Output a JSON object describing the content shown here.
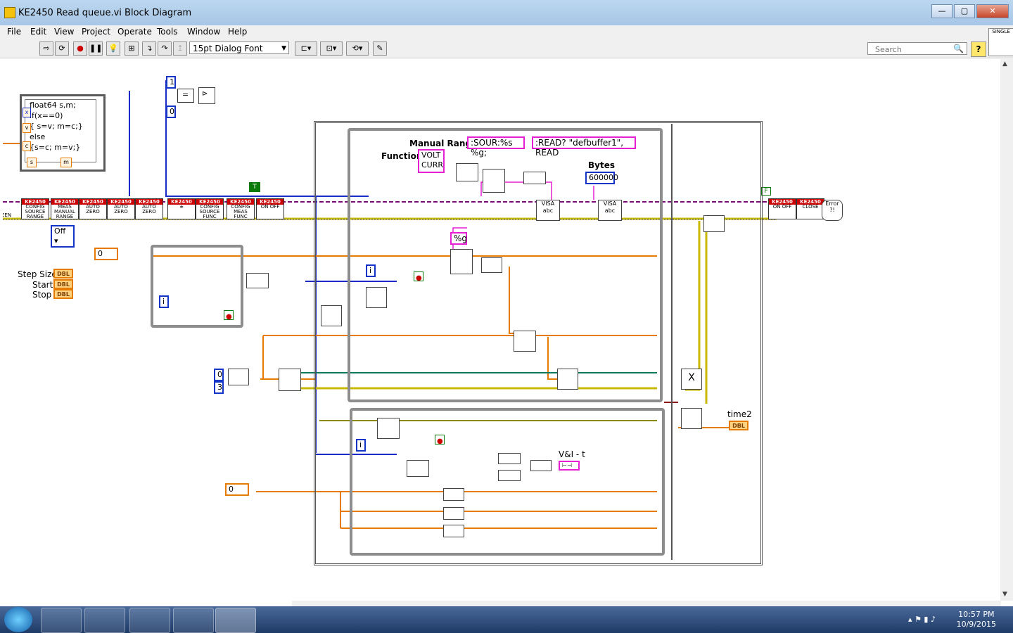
{
  "window": {
    "title": "KE2450 Read queue.vi Block Diagram"
  },
  "menu": [
    "File",
    "Edit",
    "View",
    "Project",
    "Operate",
    "Tools",
    "Window",
    "Help"
  ],
  "toolbar": {
    "font": "15pt Dialog Font"
  },
  "search": {
    "placeholder": "Search"
  },
  "single_badge": "SINGLE",
  "diagram": {
    "formula_lines": [
      "float64 s,m;",
      "if(x==0)",
      "{ s=v; m=c;}",
      "else",
      "{s=c; m=v;}"
    ],
    "formula_inputs": [
      "x",
      "v",
      "c"
    ],
    "formula_outputs": [
      "s",
      "m"
    ],
    "subvi_header": "KE2450",
    "subvis": [
      {
        "name": "CONFIG SOURCE RANGE"
      },
      {
        "name": "MEAS MANUAL RANGE"
      },
      {
        "name": "AUTO ZERO"
      },
      {
        "name": "AUTO ZERO"
      },
      {
        "name": "AUTO ZERO"
      },
      {
        "name": "CONFIG SOURCE FUNC"
      },
      {
        "name": "CONFIG MEAS FUNC"
      },
      {
        "name": "ON OFF"
      },
      {
        "name": "ON OFF"
      },
      {
        "name": "CLOSE"
      }
    ],
    "off_value": "Off",
    "const_1": "1",
    "const_0": "0",
    "const_0b": "0",
    "const_3": "3",
    "const_0c": "0",
    "const_0d": "0",
    "const_0e": "0",
    "bool_T": "T",
    "bool_F": "F",
    "labels": {
      "step_size": "Step Size",
      "start": "Start",
      "stop": "Stop",
      "manual_range": "Manual Range",
      "function": "Function",
      "bytes": "Bytes",
      "time2": "time2",
      "vi_t": "V&I - t"
    },
    "dbl": "DBL",
    "function_values": [
      "VOLT",
      "CURR"
    ],
    "sour_format": ":SOUR:%s %g;",
    "read_cmd": ":READ? \"defbuffer1\", READ",
    "bytes_value": "600000",
    "fmt_g": "%g",
    "visa": "VISA",
    "abc": "abc",
    "error_label": "Error ?!",
    "iter": "i",
    "see": "EEN"
  },
  "taskbar": {
    "time": "10:57 PM",
    "date": "10/9/2015"
  }
}
